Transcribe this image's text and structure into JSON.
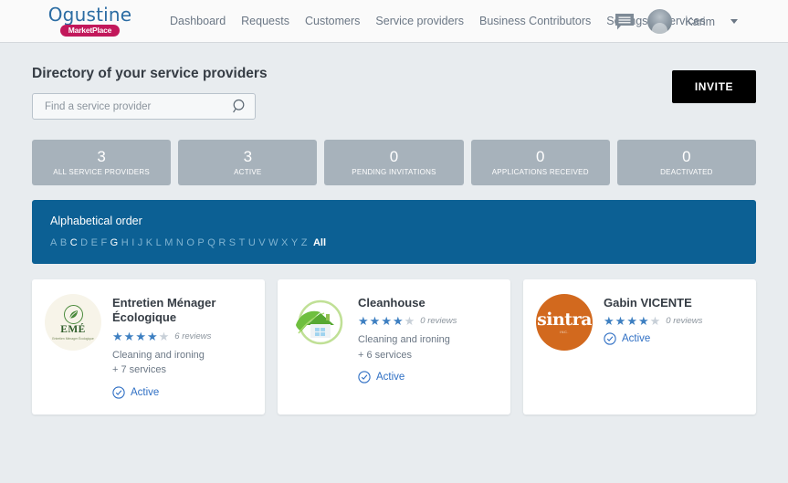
{
  "header": {
    "logo": {
      "name": "Ogustine",
      "badge": "MarketPlace"
    },
    "nav": [
      {
        "label": "Dashboard",
        "name": "nav-dashboard"
      },
      {
        "label": "Requests",
        "name": "nav-requests"
      },
      {
        "label": "Customers",
        "name": "nav-customers"
      },
      {
        "label": "Service providers",
        "name": "nav-service-providers"
      },
      {
        "label": "Business Contributors",
        "name": "nav-business-contributors"
      },
      {
        "label": "Settings & Services",
        "name": "nav-settings-services"
      }
    ],
    "messages_icon": "message-icon",
    "user": {
      "name": "Karim",
      "avatar": "user-avatar",
      "caret": "chevron-down-icon"
    }
  },
  "page": {
    "title": "Directory of your service providers",
    "search": {
      "placeholder": "Find a service provider",
      "value": "",
      "icon": "search-icon"
    },
    "invite_button": "INVITE"
  },
  "stats": [
    {
      "value": "3",
      "label": "ALL SERVICE PROVIDERS"
    },
    {
      "value": "3",
      "label": "ACTIVE"
    },
    {
      "value": "0",
      "label": "PENDING INVITATIONS"
    },
    {
      "value": "0",
      "label": "APPLICATIONS RECEIVED"
    },
    {
      "value": "0",
      "label": "DEACTIVATED"
    }
  ],
  "alphabet": {
    "title": "Alphabetical order",
    "letters": [
      "A",
      "B",
      "C",
      "D",
      "E",
      "F",
      "G",
      "H",
      "I",
      "J",
      "K",
      "L",
      "M",
      "N",
      "O",
      "P",
      "Q",
      "R",
      "S",
      "T",
      "U",
      "V",
      "W",
      "X",
      "Y",
      "Z"
    ],
    "enabled": [
      "C",
      "G"
    ],
    "all_label": "All",
    "selected": "All"
  },
  "cards": [
    {
      "name": "Entretien Ménager Écologique",
      "logo": "eme-logo",
      "logo_title": "EMÉ",
      "logo_subtitle": "Entretien Ménager Écologique",
      "rating": 4,
      "reviews": "6 reviews",
      "service_line1": "Cleaning and ironing",
      "service_line2": "+ 7 services",
      "status": "Active"
    },
    {
      "name": "Cleanhouse",
      "logo": "cleanhouse-logo",
      "rating": 4,
      "reviews": "0 reviews",
      "service_line1": "Cleaning and ironing",
      "service_line2": "+ 6 services",
      "status": "Active"
    },
    {
      "name": "Gabin VICENTE",
      "logo": "sintra-logo",
      "logo_title": "sintra",
      "logo_subtitle": "INC.",
      "rating": 4,
      "reviews": "0 reviews",
      "service_line1": "",
      "service_line2": "",
      "status": "Active"
    }
  ],
  "colors": {
    "brand_blue": "#2b6ca3",
    "brand_pink": "#c2185b",
    "panel_blue": "#0c6094",
    "stat_gray": "#a7b2bb",
    "star_blue": "#3d7fc1",
    "status_blue": "#2f6fc4",
    "page_bg": "#e8ecef"
  }
}
